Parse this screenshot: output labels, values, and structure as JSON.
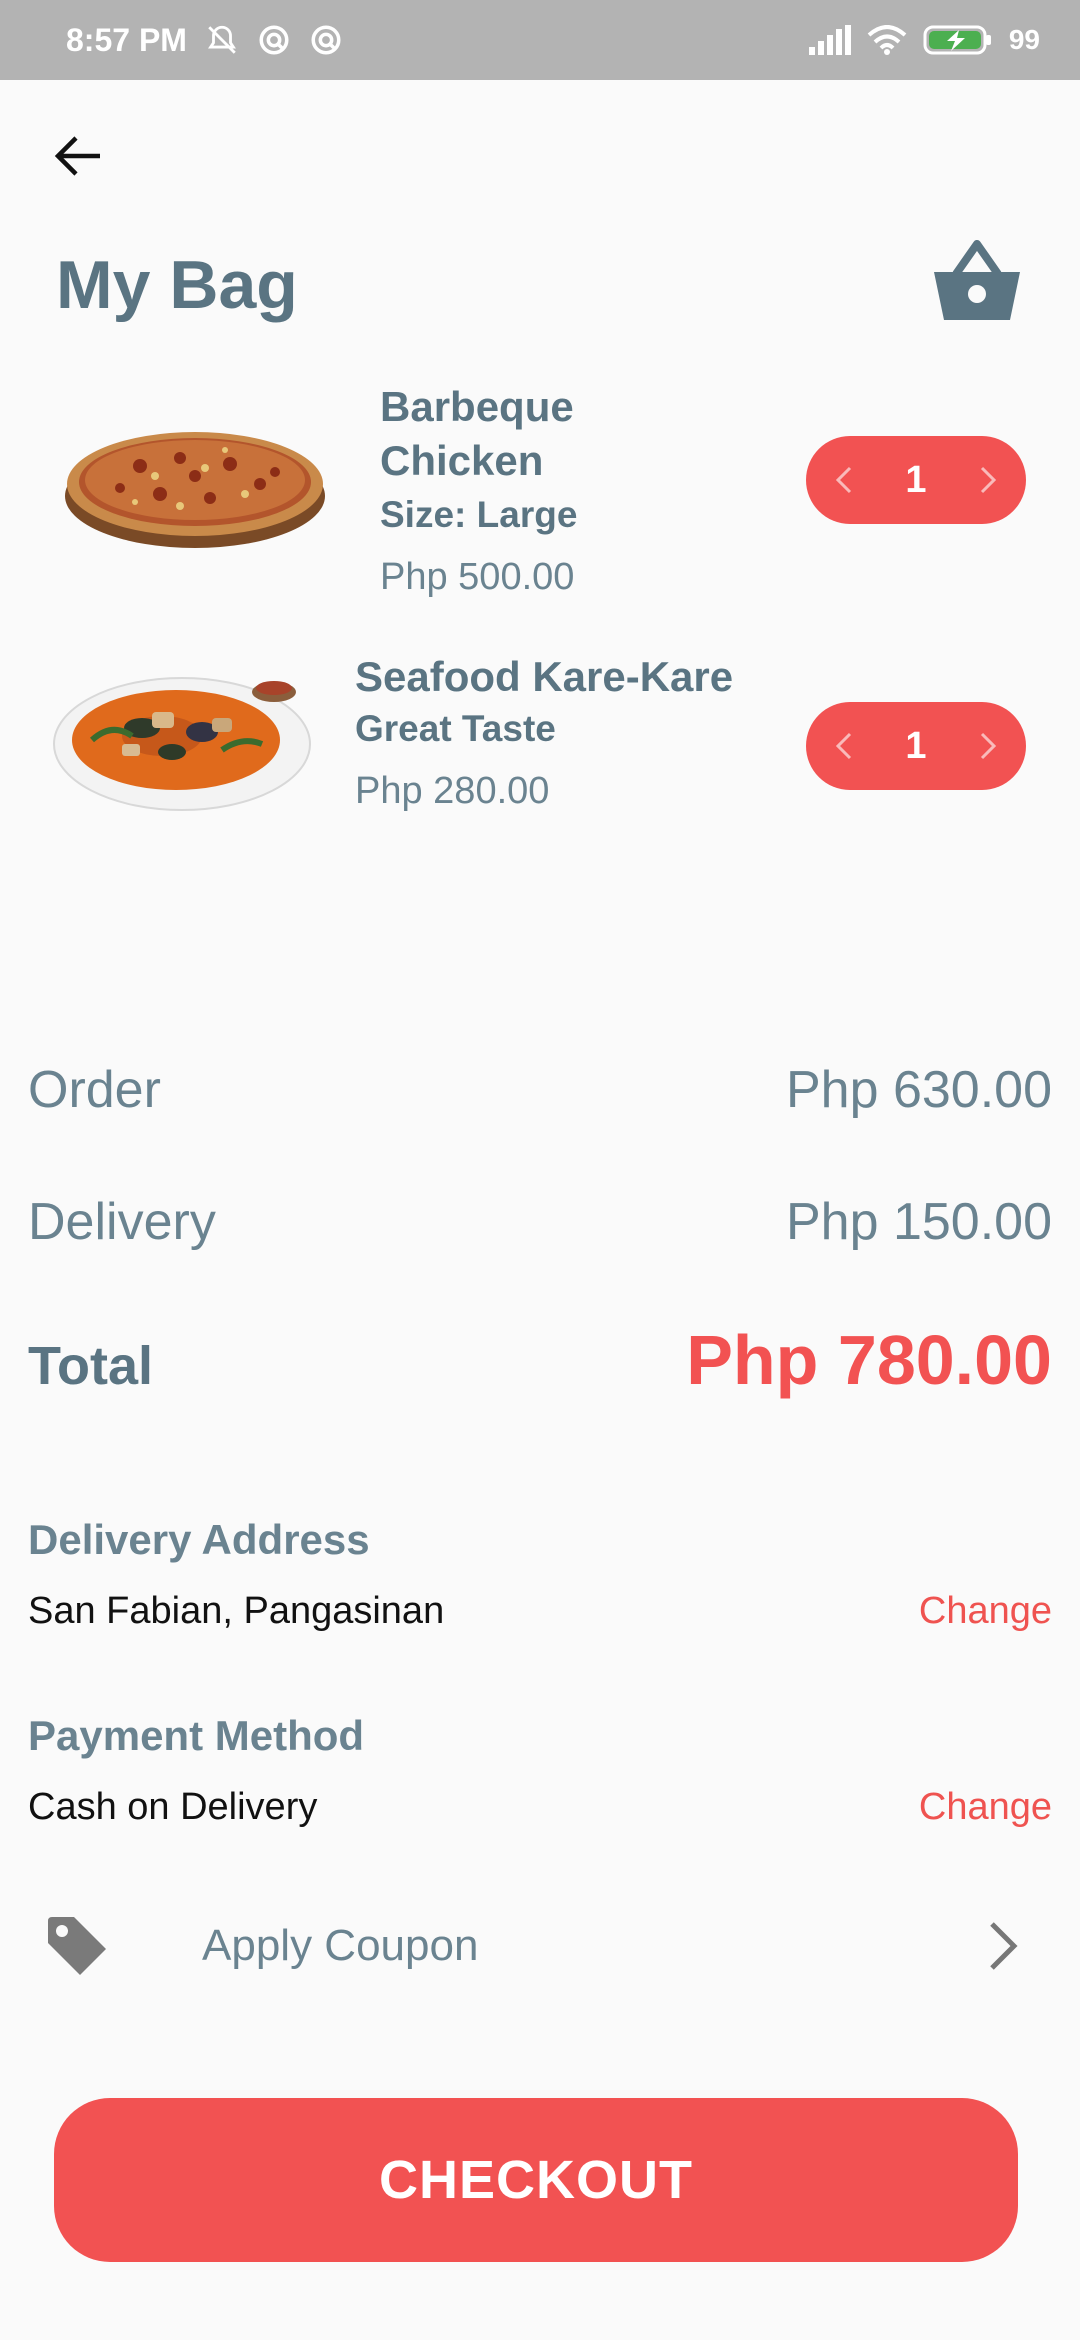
{
  "status_bar": {
    "time": "8:57 PM",
    "battery": "99",
    "icons": [
      "mute-bell-icon",
      "sync-icon",
      "sync-icon",
      "signal-icon",
      "wifi-icon",
      "battery-charging-icon"
    ]
  },
  "header": {
    "title": "My Bag",
    "back_icon": "arrow-left-icon",
    "basket_icon": "basket-icon"
  },
  "items": [
    {
      "name_line1": "Barbeque",
      "name_line2": "Chicken",
      "detail": "Size: Large",
      "price": "Php 500.00",
      "quantity": "1",
      "image": "pizza-image"
    },
    {
      "name": "Seafood Kare-Kare",
      "detail": "Great Taste",
      "price": "Php 280.00",
      "quantity": "1",
      "image": "kare-kare-image"
    }
  ],
  "summary": {
    "order_label": "Order",
    "order_value": "Php 630.00",
    "delivery_label": "Delivery",
    "delivery_value": "Php 150.00",
    "total_label": "Total",
    "total_value": "Php 780.00"
  },
  "delivery_address": {
    "title": "Delivery Address",
    "value": "San Fabian, Pangasinan",
    "change_label": "Change"
  },
  "payment_method": {
    "title": "Payment Method",
    "value": "Cash on Delivery",
    "change_label": "Change"
  },
  "coupon": {
    "label": "Apply Coupon",
    "icon": "tag-icon"
  },
  "checkout": {
    "label": "CHECKOUT"
  },
  "colors": {
    "accent": "#f25252",
    "heading": "#5a7482",
    "text_muted": "#6a8390",
    "status_bar": "#b3b3b3"
  }
}
